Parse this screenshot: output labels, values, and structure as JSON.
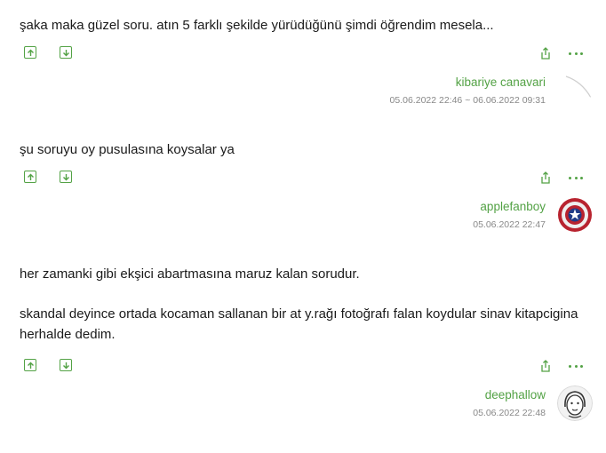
{
  "entries": [
    {
      "paragraphs": [
        "şaka maka güzel soru. atın 5 farklı şekilde yürüdüğünü şimdi öğrendim mesela..."
      ],
      "author": "kibariye canavari",
      "date": "05.06.2022 22:46 ~ 06.06.2022 09:31",
      "avatar_icon": "blank-avatar-icon"
    },
    {
      "paragraphs": [
        "şu soruyu oy pusulasına koysalar ya"
      ],
      "author": "applefanboy",
      "date": "05.06.2022 22:47",
      "avatar_icon": "captain-america-shield-icon"
    },
    {
      "paragraphs": [
        "her zamanki gibi ekşici abartmasına maruz kalan sorudur.",
        "skandal deyince ortada kocaman sallanan bir at y.rağı fotoğrafı falan koydular sinav kitapcigina herhalde dedim."
      ],
      "author": "deephallow",
      "date": "05.06.2022 22:48",
      "avatar_icon": "cartoon-face-icon"
    }
  ],
  "colors": {
    "accent": "#53a245",
    "date": "#888888",
    "text": "#1a1a1a"
  },
  "icons": {
    "upvote": "upvote-icon",
    "downvote": "downvote-icon",
    "share": "share-icon",
    "more": "more-options-icon"
  }
}
